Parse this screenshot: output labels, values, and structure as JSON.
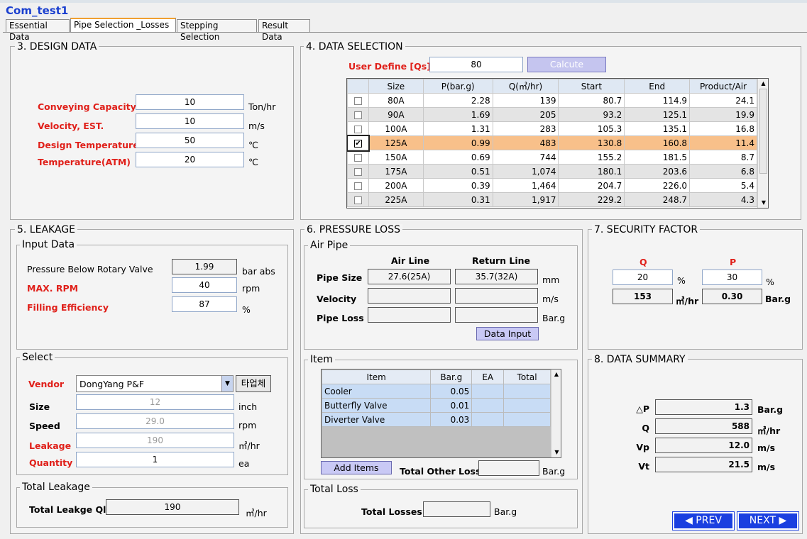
{
  "app": {
    "title": "Com_test1"
  },
  "tabs": [
    "Essential Data",
    "Pipe Selection _Losses",
    "Stepping Selection",
    "Result Data"
  ],
  "design": {
    "legend": "3. DESIGN DATA",
    "rows": [
      {
        "label": "Conveying Capacity",
        "value": "10",
        "unit": "Ton/hr"
      },
      {
        "label": "Velocity, EST.",
        "value": "10",
        "unit": "m/s"
      },
      {
        "label": "Design Temperature",
        "value": "50",
        "unit": "℃"
      },
      {
        "label": "Temperature(ATM)",
        "value": "20",
        "unit": "℃"
      }
    ]
  },
  "selection": {
    "legend": "4. DATA SELECTION",
    "user_label": "User Define [Qs]",
    "user_value": "80",
    "calc_label": "Calcute",
    "headers": [
      "Size",
      "P(bar.g)",
      "Q(㎥/hr)",
      "Start",
      "End",
      "Product/Air"
    ],
    "rows": [
      {
        "checked": false,
        "cells": [
          "80A",
          "2.28",
          "139",
          "80.7",
          "114.9",
          "24.1"
        ]
      },
      {
        "checked": false,
        "cells": [
          "90A",
          "1.69",
          "205",
          "93.2",
          "125.1",
          "19.9"
        ]
      },
      {
        "checked": false,
        "cells": [
          "100A",
          "1.31",
          "283",
          "105.3",
          "135.1",
          "16.8"
        ]
      },
      {
        "checked": true,
        "cells": [
          "125A",
          "0.99",
          "483",
          "130.8",
          "160.8",
          "11.4"
        ]
      },
      {
        "checked": false,
        "cells": [
          "150A",
          "0.69",
          "744",
          "155.2",
          "181.5",
          "8.7"
        ]
      },
      {
        "checked": false,
        "cells": [
          "175A",
          "0.51",
          "1,074",
          "180.1",
          "203.6",
          "6.8"
        ]
      },
      {
        "checked": false,
        "cells": [
          "200A",
          "0.39",
          "1,464",
          "204.7",
          "226.0",
          "5.4"
        ]
      },
      {
        "checked": false,
        "cells": [
          "225A",
          "0.31",
          "1,917",
          "229.2",
          "248.7",
          "4.3"
        ]
      }
    ]
  },
  "leakage": {
    "legend": "5. LEAKAGE",
    "input_legend": "Input Data",
    "inputs": [
      {
        "label": "Pressure Below Rotary Valve",
        "value": "1.99",
        "unit": "bar abs"
      },
      {
        "label": "MAX. RPM",
        "value": "40",
        "unit": "rpm"
      },
      {
        "label": "Filling Efficiency",
        "value": "87",
        "unit": "%"
      }
    ],
    "select_legend": "Select",
    "vendor_label": "Vendor",
    "vendor_value": "DongYang P&F",
    "other_vendor": "타업체",
    "select_rows": [
      {
        "label": "Size",
        "value": "12",
        "unit": "inch"
      },
      {
        "label": "Speed",
        "value": "29.0",
        "unit": "rpm"
      },
      {
        "label": "Leakage",
        "value": "190",
        "unit": "㎥/hr"
      },
      {
        "label": "Quantity",
        "value": "1",
        "unit": "ea"
      }
    ],
    "total_legend": "Total Leakage",
    "total_label": "Total Leakge Ql",
    "total_value": "190",
    "total_unit": "㎥/hr"
  },
  "pressure": {
    "legend": "6. PRESSURE LOSS",
    "air_legend": "Air Pipe",
    "col_air": "Air Line",
    "col_return": "Return Line",
    "rows": [
      {
        "label": "Pipe Size",
        "air": "27.6(25A)",
        "ret": "35.7(32A)",
        "unit": "mm"
      },
      {
        "label": "Velocity",
        "air": "",
        "ret": "",
        "unit": "m/s"
      },
      {
        "label": "Pipe Loss",
        "air": "",
        "ret": "",
        "unit": "Bar.g"
      }
    ],
    "data_input": "Data Input",
    "item_legend": "Item",
    "item_headers": [
      "Item",
      "Bar.g",
      "EA",
      "Total"
    ],
    "items": [
      {
        "name": "Cooler",
        "bar": "0.05",
        "ea": "",
        "total": ""
      },
      {
        "name": "Butterfly Valve",
        "bar": "0.01",
        "ea": "",
        "total": ""
      },
      {
        "name": "Diverter Valve",
        "bar": "0.03",
        "ea": "",
        "total": ""
      }
    ],
    "add_items": "Add Items",
    "other_loss_label": "Total Other Loss",
    "other_loss_value": "",
    "other_loss_unit": "Bar.g",
    "total_legend": "Total Loss",
    "total_label": "Total Losses",
    "total_value": "",
    "total_unit": "Bar.g"
  },
  "security": {
    "legend": "7. SECURITY FACTOR",
    "q_label": "Q",
    "p_label": "P",
    "q_value": "20",
    "q_unit": "%",
    "p_value": "30",
    "p_unit": "%",
    "q_result": "153",
    "q_result_unit": "㎥/hr",
    "p_result": "0.30",
    "p_result_unit": "Bar.g"
  },
  "summary": {
    "legend": "8. DATA SUMMARY",
    "rows": [
      {
        "label": "△P",
        "value": "1.3",
        "unit": "Bar.g"
      },
      {
        "label": "Q",
        "value": "588",
        "unit": "㎥/hr"
      },
      {
        "label": "Vp",
        "value": "12.0",
        "unit": "m/s"
      },
      {
        "label": "Vt",
        "value": "21.5",
        "unit": "m/s"
      }
    ]
  },
  "nav": {
    "prev": "◀ PREV",
    "next": "NEXT ▶"
  },
  "colors": {
    "accent": "#1a3fe0",
    "label_red": "#e0201a",
    "selected_row": "#f8c08a",
    "button": "#c9c9f5"
  }
}
